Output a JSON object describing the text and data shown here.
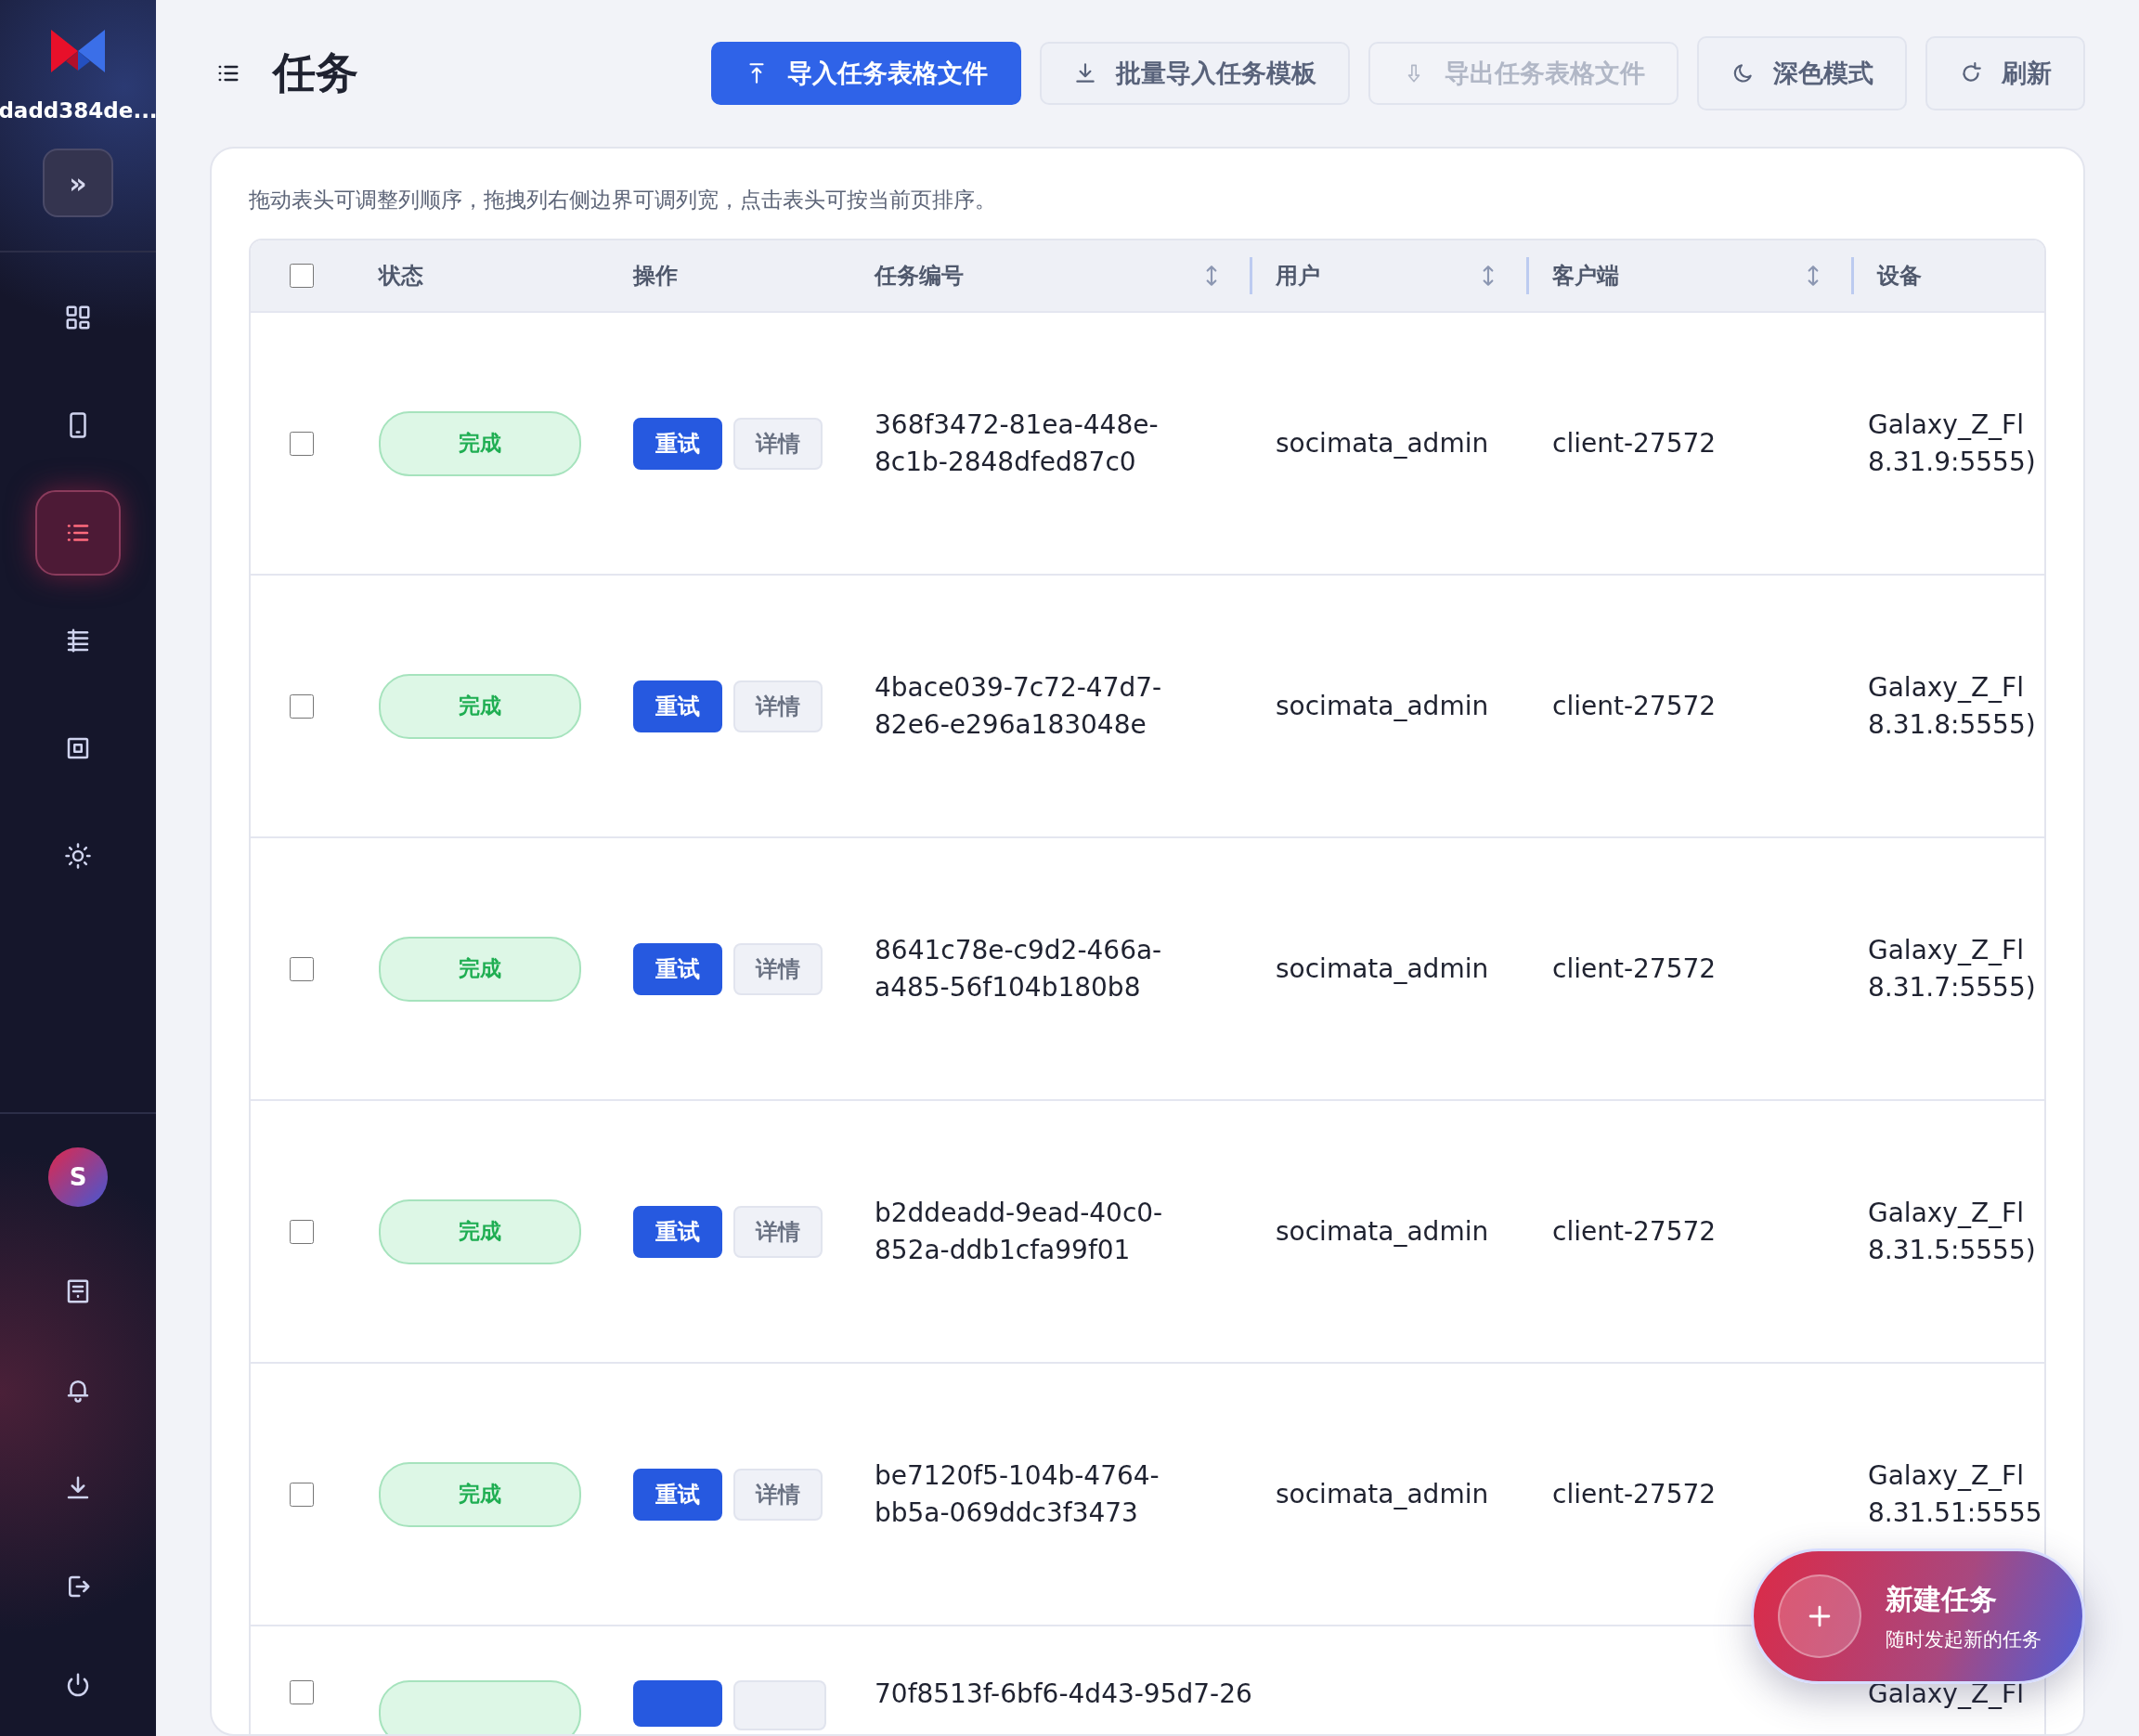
{
  "sidebar": {
    "workspace": "dadd384de...",
    "expand_label": "»",
    "nav": [
      {
        "selected": false
      },
      {
        "selected": false
      },
      {
        "selected": true
      },
      {
        "selected": false
      },
      {
        "selected": false
      },
      {
        "selected": false
      }
    ],
    "avatar": "S"
  },
  "header": {
    "title": "任务",
    "buttons": [
      {
        "label": "导入任务表格文件",
        "kind": "primary",
        "disabled": false
      },
      {
        "label": "批量导入任务模板",
        "kind": "secondary",
        "disabled": false
      },
      {
        "label": "导出任务表格文件",
        "kind": "secondary",
        "disabled": true
      },
      {
        "label": "深色模式",
        "kind": "secondary",
        "disabled": false
      },
      {
        "label": "刷新",
        "kind": "secondary",
        "disabled": false
      }
    ]
  },
  "hint": "拖动表头可调整列顺序，拖拽列右侧边界可调列宽，点击表头可按当前页排序。",
  "table": {
    "select_all_checked": false,
    "columns": [
      {
        "label": "状态",
        "sortable": false
      },
      {
        "label": "操作",
        "sortable": false
      },
      {
        "label": "任务编号",
        "sortable": true
      },
      {
        "label": "用户",
        "sortable": true
      },
      {
        "label": "客户端",
        "sortable": true
      },
      {
        "label": "设备",
        "sortable": false
      }
    ],
    "rows": [
      {
        "checked": false,
        "status": "完成",
        "actions": [
          "重试",
          "详情"
        ],
        "task_id": "368f3472-81ea-448e-8c1b-2848dfed87c0",
        "user": "socimata_admin",
        "client": "client-27572",
        "device_lines": [
          "Galaxy_Z_Fl",
          "8.31.9:5555)"
        ]
      },
      {
        "checked": false,
        "status": "完成",
        "actions": [
          "重试",
          "详情"
        ],
        "task_id": "4bace039-7c72-47d7-82e6-e296a183048e",
        "user": "socimata_admin",
        "client": "client-27572",
        "device_lines": [
          "Galaxy_Z_Fl",
          "8.31.8:5555)"
        ]
      },
      {
        "checked": false,
        "status": "完成",
        "actions": [
          "重试",
          "详情"
        ],
        "task_id": "8641c78e-c9d2-466a-a485-56f104b180b8",
        "user": "socimata_admin",
        "client": "client-27572",
        "device_lines": [
          "Galaxy_Z_Fl",
          "8.31.7:5555)"
        ]
      },
      {
        "checked": false,
        "status": "完成",
        "actions": [
          "重试",
          "详情"
        ],
        "task_id": "b2ddeadd-9ead-40c0-852a-ddb1cfa99f01",
        "user": "socimata_admin",
        "client": "client-27572",
        "device_lines": [
          "Galaxy_Z_Fl",
          "8.31.5:5555)"
        ]
      },
      {
        "checked": false,
        "status": "完成",
        "actions": [
          "重试",
          "详情"
        ],
        "task_id": "be7120f5-104b-4764-bb5a-069ddc3f3473",
        "user": "socimata_admin",
        "client": "client-27572",
        "device_lines": [
          "Galaxy_Z_Fl",
          "8.31.51:5555"
        ]
      },
      {
        "kind": "cut",
        "checked": false,
        "task_id": "70f8513f-6bf6-4d43-95d7-26",
        "device_lines": [
          "Galaxy_Z_Fl"
        ]
      }
    ]
  },
  "fab": {
    "title": "新建任务",
    "subtitle": "随时发起新的任务"
  }
}
